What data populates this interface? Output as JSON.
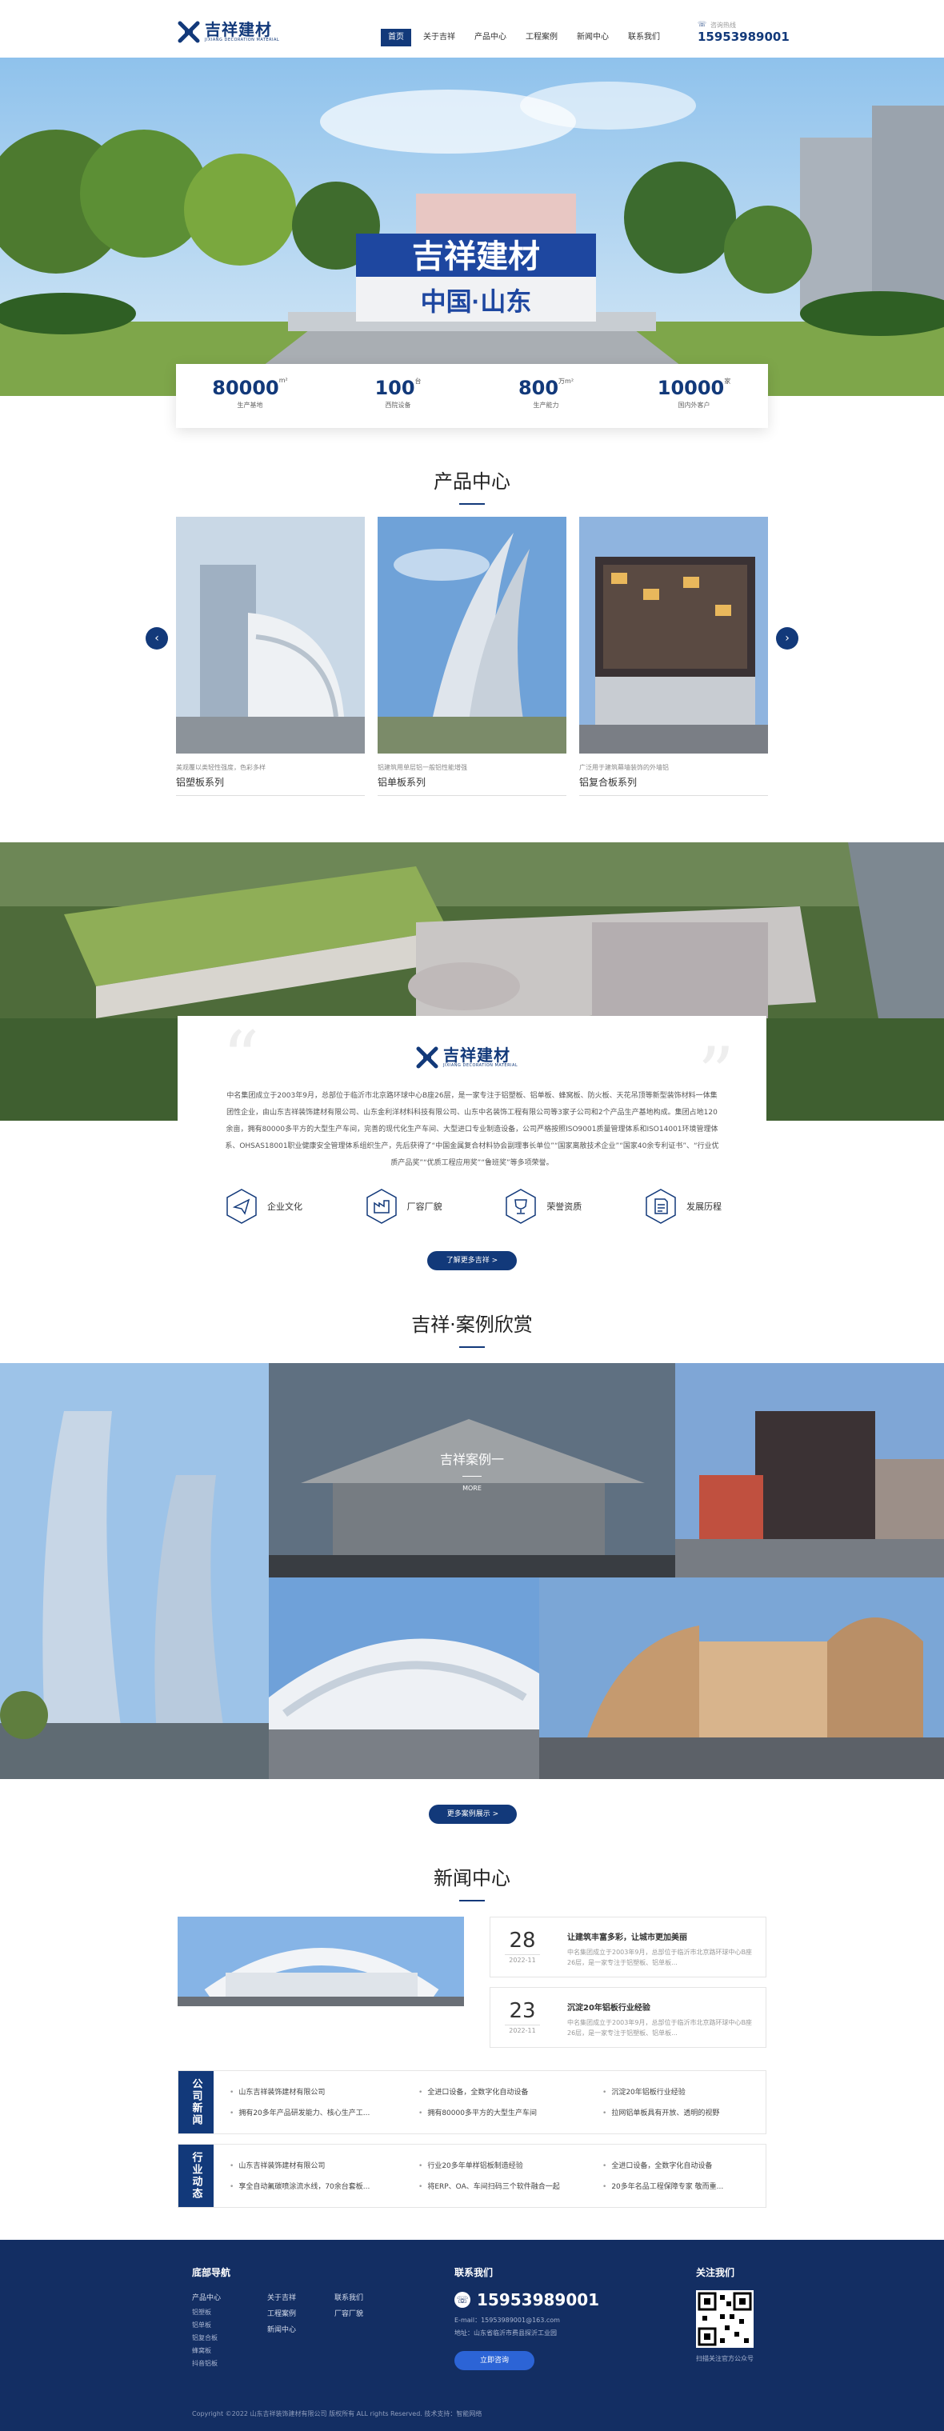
{
  "brand": {
    "name_cn": "吉祥建材",
    "name_en": "JIXIANG DECORATION MATERIAL",
    "color_primary": "#12397a",
    "color_footer": "#132e63"
  },
  "nav": {
    "items": [
      "首页",
      "关于吉祥",
      "产品中心",
      "工程案例",
      "新闻中心",
      "联系我们"
    ],
    "active": "首页"
  },
  "header_phone": {
    "label": "咨询热线",
    "number": "15953989001",
    "icon": "phone-icon"
  },
  "banner": {
    "sign_line1": "吉祥建材",
    "sign_line2": "中国·山东"
  },
  "stats": [
    {
      "number": "80000",
      "unit": "m²",
      "label": "生产基地"
    },
    {
      "number": "100",
      "unit": "台",
      "label": "西院设备"
    },
    {
      "number": "800",
      "unit": "万m²",
      "label": "生产能力"
    },
    {
      "number": "10000",
      "unit": "家",
      "label": "国内外客户"
    }
  ],
  "products": {
    "title": "产品中心",
    "items": [
      {
        "desc": "美观覆以类轻性强度，色彩多样",
        "name": "铝塑板系列"
      },
      {
        "desc": "铝建筑用单层铝一般铝性能增强",
        "name": "铝单板系列"
      },
      {
        "desc": "广泛用于建筑幕墙装饰的外墙铝",
        "name": "铝复合板系列"
      }
    ]
  },
  "about": {
    "paragraph": "中名集团成立于2003年9月，总部位于临沂市北京路环球中心B座26层，是一家专注于铝塑板、铝单板、蜂窝板、防火板、天花吊顶等新型装饰材料一体集团性企业，由山东吉祥装饰建材有限公司、山东金利洋材料科技有限公司、山东中名装饰工程有限公司等3家子公司和2个产品生产基地构成。集团占地120余亩，拥有80000多平方的大型生产车间，完善的现代化生产车间、大型进口专业制造设备，公司严格按照ISO9001质量管理体系和ISO14001环境管理体系、OHSAS18001职业健康安全管理体系组织生产，先后获得了“中国金属复合材料协会副理事长单位”“国家离散技术企业”“国家40余专利证书”、“行业优质产品奖”“优质工程应用奖”“鲁班奖”等多项荣誉。",
    "icons": [
      {
        "icon": "paper-plane-icon",
        "label": "企业文化"
      },
      {
        "icon": "factory-icon",
        "label": "厂容厂貌"
      },
      {
        "icon": "trophy-icon",
        "label": "荣誉资质"
      },
      {
        "icon": "document-icon",
        "label": "发展历程"
      }
    ],
    "button": "了解更多吉祥 >"
  },
  "cases": {
    "title": "吉祥·案例欣赏",
    "featured_title": "吉祥案例一",
    "featured_more": "MORE",
    "button": "更多案例展示 >"
  },
  "news": {
    "title": "新闻中心",
    "items": [
      {
        "day": "28",
        "ym": "2022-11",
        "title": "让建筑丰富多彩，让城市更加美丽",
        "summary": "中名集团成立于2003年9月，总部位于临沂市北京路环球中心B座26层，是一家专注于铝塑板、铝单板..."
      },
      {
        "day": "23",
        "ym": "2022-11",
        "title": "沉淀20年铝板行业经验",
        "summary": "中名集团成立于2003年9月，总部位于临沂市北京路环球中心B座26层，是一家专注于铝塑板、铝单板..."
      }
    ],
    "company_news": {
      "tag": "公司新闻",
      "col1": [
        "山东吉祥装饰建材有限公司",
        "拥有20多年产品研发能力、核心生产工..."
      ],
      "col2": [
        "全进口设备，全数字化自动设备",
        "拥有80000多平方的大型生产车间"
      ],
      "col3": [
        "沉淀20年铝板行业经验",
        "拉网铝单板具有开放、透明的视野"
      ]
    },
    "industry_news": {
      "tag": "行业动态",
      "col1": [
        "山东吉祥装饰建材有限公司",
        "享全自动氟碳喷涂流水线，70余台套板..."
      ],
      "col2": [
        "行业20多年单样铝板制造经验",
        "将ERP、OA、车间扫码三个软件融合一起"
      ],
      "col3": [
        "全进口设备，全数字化自动设备",
        "20多年名品工程保障专家 敬而重..."
      ]
    }
  },
  "footer": {
    "nav_title": "底部导航",
    "nav_col1": [
      "产品中心",
      "铝塑板",
      "铝单板",
      "铝复合板",
      "蜂窝板",
      "抖音铝板"
    ],
    "nav_col2": [
      "关于吉祥",
      "工程案例",
      "新闻中心"
    ],
    "nav_col3": [
      "联系我们",
      "厂容厂貌"
    ],
    "contact_title": "联系我们",
    "phone": "15953989001",
    "email": "E-mail：15953989001@163.com",
    "address": "地址：山东省临沂市费县探沂工业园",
    "contact_button": "立即咨询",
    "follow_title": "关注我们",
    "qr_caption": "扫描关注官方公众号",
    "copyright": "Copyright ©2022 山东吉祥装饰建材有限公司 版权所有 ALL rights Reserved.  技术支持：智能网络"
  }
}
